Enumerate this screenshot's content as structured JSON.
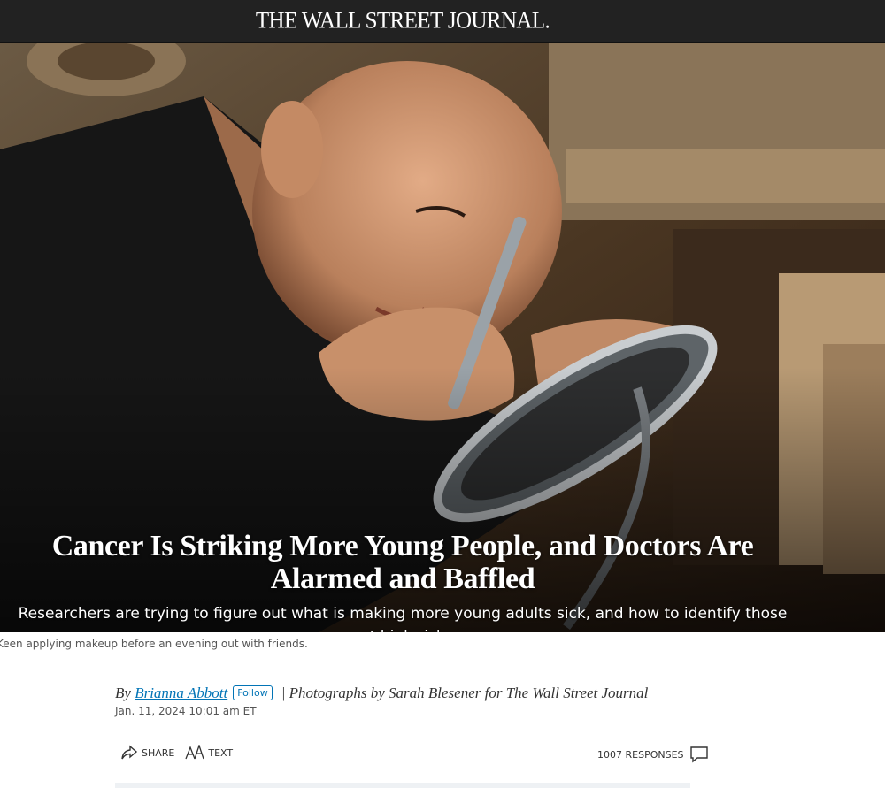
{
  "masthead": {
    "logo": "THE WALL STREET JOURNAL."
  },
  "article": {
    "headline": "Cancer Is Striking More Young People, and Doctors Are Alarmed and Baffled",
    "dek": "Researchers are trying to figure out what is making more young adults sick, and how to identify those at high risk",
    "caption": "Keen applying makeup before an evening out with friends.",
    "byline": {
      "prefix": "By",
      "author": "Brianna Abbott",
      "follow_label": "Follow",
      "photo_credit": "| Photographs by Sarah Blesener for The Wall Street Journal"
    },
    "date": "Jan. 11, 2024 10:01 am ET"
  },
  "tools": {
    "share_label": "SHARE",
    "text_label": "TEXT",
    "responses_label": "1007 RESPONSES"
  },
  "icons": [
    "share-icon",
    "text-size-icon",
    "comment-icon"
  ],
  "colors": {
    "masthead_bg": "#222222",
    "link": "#0274b6"
  }
}
